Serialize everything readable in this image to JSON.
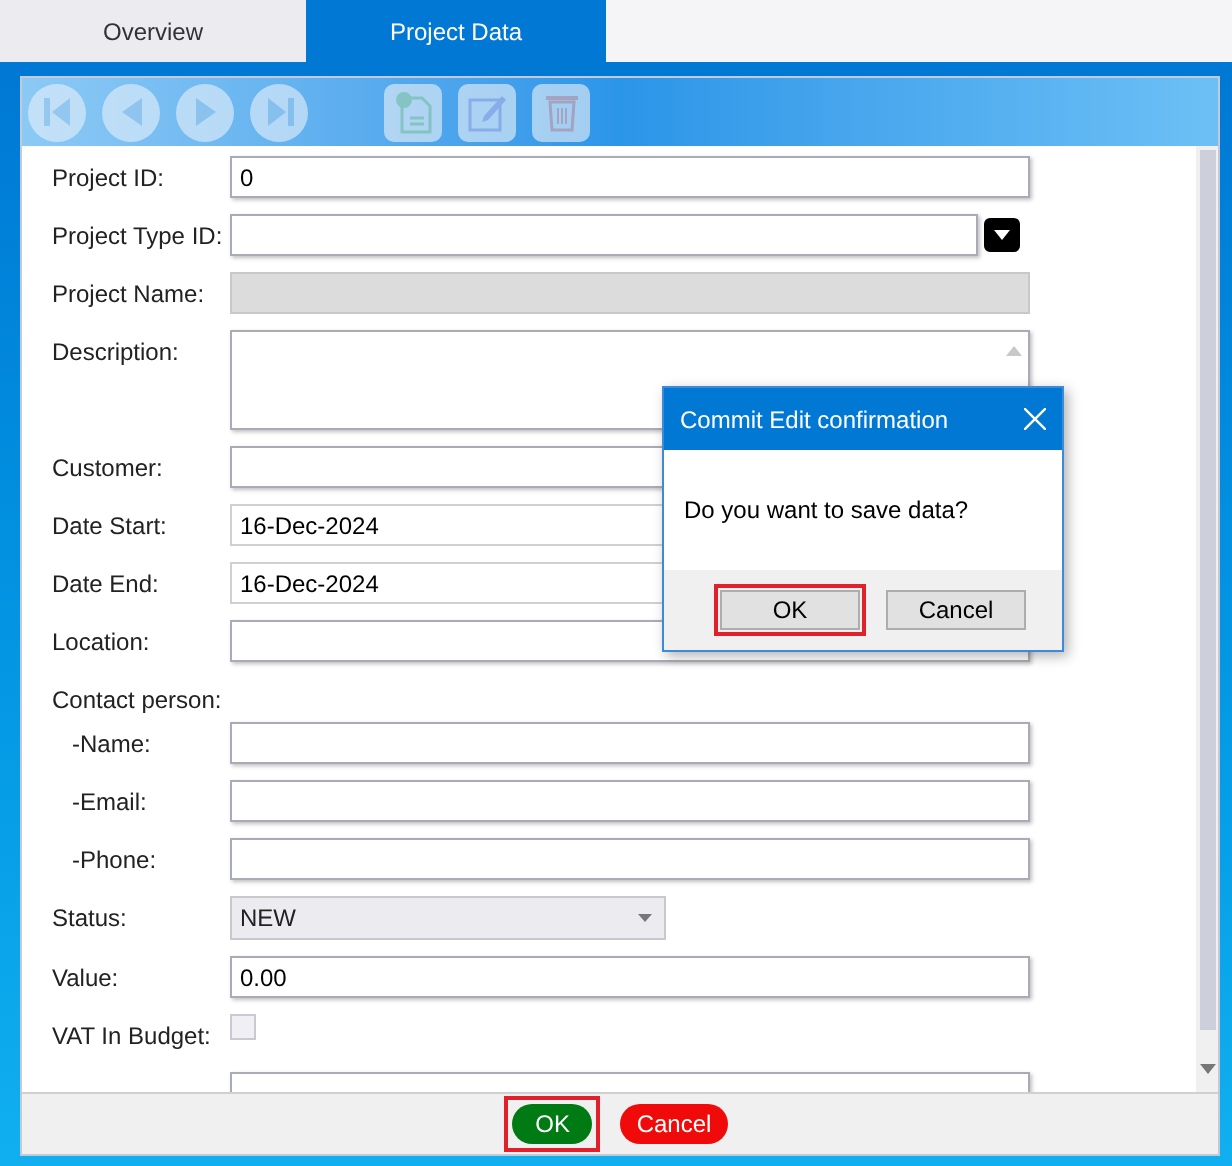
{
  "tabs": [
    {
      "label": "Overview",
      "selected": false
    },
    {
      "label": "Project Data",
      "selected": true
    }
  ],
  "toolbar": [
    {
      "kind": "first",
      "disabled": true
    },
    {
      "kind": "prev",
      "disabled": true
    },
    {
      "kind": "next",
      "disabled": true
    },
    {
      "kind": "last",
      "disabled": true
    },
    {
      "kind": "add",
      "disabled": true
    },
    {
      "kind": "edit",
      "disabled": true
    },
    {
      "kind": "delete",
      "disabled": true
    }
  ],
  "fields": [
    {
      "kind": "text",
      "label": "Project ID:",
      "value": "0"
    },
    {
      "kind": "combo",
      "label": "Project Type ID:"
    },
    {
      "kind": "readonly",
      "label": "Project Name:"
    },
    {
      "kind": "textarea",
      "label": "Description:"
    },
    {
      "kind": "text",
      "label": "Customer:"
    },
    {
      "kind": "date",
      "label": "Date Start:",
      "value": "16-Dec-2024"
    },
    {
      "kind": "date",
      "label": "Date End:",
      "value": "16-Dec-2024"
    },
    {
      "kind": "text",
      "label": "Location:"
    },
    {
      "kind": "heading",
      "label": "Contact person:",
      "children": [
        {
          "kind": "text",
          "label": "-Name:"
        },
        {
          "kind": "text",
          "label": "-Email:"
        },
        {
          "kind": "text",
          "label": "-Phone:"
        }
      ]
    },
    {
      "kind": "select",
      "label": "Status:",
      "value": "NEW"
    },
    {
      "kind": "text",
      "label": "Value:",
      "value": "0.00"
    },
    {
      "kind": "checkbox",
      "label": "VAT In Budget:",
      "checked": false
    },
    {
      "kind": "text"
    }
  ],
  "footer_buttons": [
    {
      "kind": "ok",
      "label": "OK",
      "focused": true
    },
    {
      "kind": "cancel",
      "label": "Cancel",
      "focused": false
    }
  ],
  "dialog": {
    "title": "Commit Edit confirmation",
    "message": "Do you want to save data?",
    "buttons": [
      {
        "label": "OK",
        "focused": true
      },
      {
        "label": "Cancel",
        "focused": false
      }
    ]
  }
}
